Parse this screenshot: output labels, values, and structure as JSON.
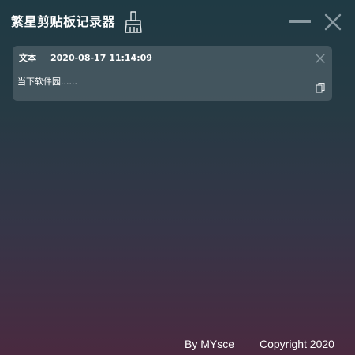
{
  "app": {
    "title": "繁星剪贴板记录器"
  },
  "toolbar": {
    "clear_icon": "brush-broom-icon",
    "minimize_icon": "minimize-icon",
    "close_icon": "close-icon"
  },
  "records": [
    {
      "type": "文本",
      "time": "2020-08-17 11:14:09",
      "content": "当下软件园......",
      "delete_icon": "close-icon",
      "copy_icon": "copy-icon"
    }
  ],
  "footer": {
    "author": "By MYsce",
    "copyright": "Copyright 2020"
  },
  "colors": {
    "gradient_top": "#1f3a44",
    "gradient_bottom": "#4a2a40",
    "card_bg": "#5c6c74",
    "icon_muted": "#8a9aa2"
  }
}
